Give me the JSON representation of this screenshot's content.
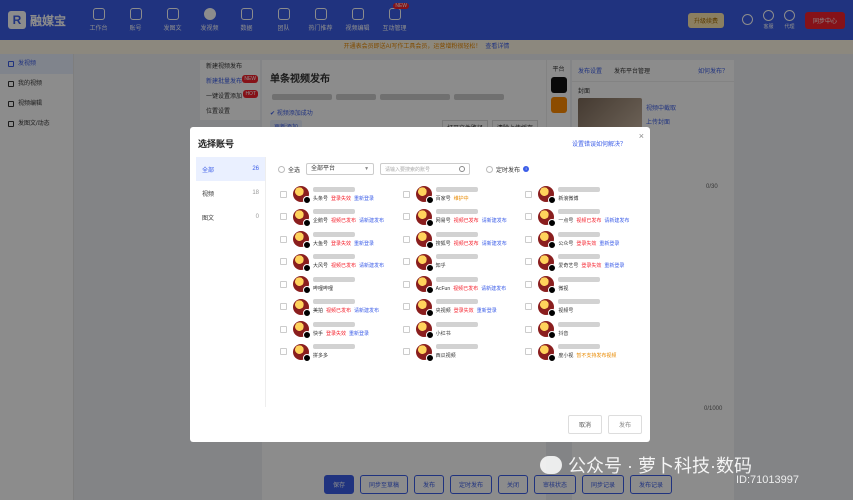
{
  "app": {
    "name": "融媒宝"
  },
  "nav": [
    {
      "label": "工作台",
      "icon": "home-icon"
    },
    {
      "label": "账号",
      "icon": "user-icon"
    },
    {
      "label": "发图文",
      "icon": "image-icon"
    },
    {
      "label": "发视频",
      "icon": "play-icon",
      "active": true
    },
    {
      "label": "数据",
      "icon": "chart-icon"
    },
    {
      "label": "团队",
      "icon": "team-icon"
    },
    {
      "label": "热门推荐",
      "icon": "fire-icon"
    },
    {
      "label": "视频编辑",
      "icon": "edit-icon"
    },
    {
      "label": "互动管理",
      "icon": "chat-icon",
      "badge": "NEW"
    }
  ],
  "top_right": {
    "upgrade": "升级续费",
    "items": [
      "客服",
      "代理"
    ],
    "sync": "同步中心"
  },
  "notice": {
    "text": "开通表会员即送AI写作工具会员，运营增粉很轻松！",
    "link": "查看详情"
  },
  "sidebar": [
    {
      "label": "发视频",
      "active": true
    },
    {
      "label": "我的视频"
    },
    {
      "label": "视频编辑"
    },
    {
      "label": "发图文/动态"
    }
  ],
  "substeps": [
    {
      "label": "新建视频发布"
    },
    {
      "label": "新建批量发布",
      "active": true,
      "tag": "NEW"
    },
    {
      "label": "一键设置添加",
      "tag": "HOT"
    },
    {
      "label": "位置设置"
    }
  ],
  "main": {
    "title": "单条视频发布",
    "uploaded": "视频添加成功",
    "replace": "更新添加",
    "open_path": "打开文件路径",
    "clear_cache": "清除上传缓存"
  },
  "platform_col": {
    "label": "平台"
  },
  "right_panel": {
    "tabs": [
      "发布设置",
      "发布平台管理"
    ],
    "help": "如何发布？",
    "cover_label": "封面",
    "cover_links": [
      "视频中截取",
      "上传封面"
    ],
    "title_counter": "0/30",
    "desc_counter": "0/1000"
  },
  "bottom_buttons": [
    "保存",
    "同步至草稿",
    "发布",
    "定时发布",
    "关闭",
    "审核状态",
    "同步记录",
    "发布记录"
  ],
  "modal": {
    "title": "选择账号",
    "help": "设置错误如何解决？",
    "close": "×",
    "categories": [
      {
        "label": "全部",
        "count": "26",
        "active": true
      },
      {
        "label": "视频",
        "count": "18"
      },
      {
        "label": "图文",
        "count": "0"
      }
    ],
    "select_all": "全选",
    "platform_select": "全部平台",
    "search_placeholder": "请输入要搜索的账号",
    "timed_publish": "定时发布",
    "accounts": [
      {
        "platform": "头条号",
        "status": "登录失效",
        "action": "重新登录"
      },
      {
        "platform": "百家号",
        "status": "维护中",
        "ok": true,
        "action": ""
      },
      {
        "platform": "新浪微博",
        "status": "",
        "action": ""
      },
      {
        "platform": "企鹅号",
        "status": "视频已发布",
        "action": "请新建发布"
      },
      {
        "platform": "网易号",
        "status": "视频已发布",
        "action": "请新建发布"
      },
      {
        "platform": "一点号",
        "status": "视频已发布",
        "action": "请新建发布"
      },
      {
        "platform": "大鱼号",
        "status": "登录失效",
        "action": "重新登录"
      },
      {
        "platform": "搜狐号",
        "status": "视频已发布",
        "action": "请新建发布"
      },
      {
        "platform": "公众号",
        "status": "登录失效",
        "action": "重新登录"
      },
      {
        "platform": "大风号",
        "status": "视频已发布",
        "action": "请新建发布"
      },
      {
        "platform": "知乎",
        "status": "",
        "action": ""
      },
      {
        "platform": "爱奇艺号",
        "status": "登录失效",
        "action": "重新登录"
      },
      {
        "platform": "哔哩哔哩",
        "status": "",
        "action": ""
      },
      {
        "platform": "AcFun",
        "status": "视频已发布",
        "action": "请新建发布"
      },
      {
        "platform": "微视",
        "status": "",
        "action": ""
      },
      {
        "platform": "美拍",
        "status": "视频已发布",
        "action": "请新建发布"
      },
      {
        "platform": "央视频",
        "status": "登录失效",
        "action": "重新登录"
      },
      {
        "platform": "视频号",
        "status": "",
        "action": ""
      },
      {
        "platform": "快手",
        "status": "登录失效",
        "action": "重新登录"
      },
      {
        "platform": "小红书",
        "status": "",
        "action": ""
      },
      {
        "platform": "抖音",
        "status": "",
        "action": ""
      },
      {
        "platform": "拼多多",
        "status": "",
        "action": ""
      },
      {
        "platform": "西瓜视频",
        "status": "",
        "action": ""
      },
      {
        "platform": "度小视",
        "status": "暂不支持发布视频",
        "ok": true,
        "action": ""
      }
    ],
    "cancel": "取消",
    "confirm": "发布"
  },
  "watermark": {
    "text": "公众号 · 萝卜科技·数码",
    "id": "ID:71013997"
  }
}
